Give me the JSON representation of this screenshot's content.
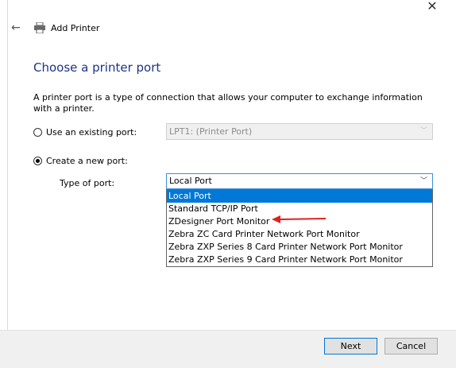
{
  "window": {
    "title": "Add Printer",
    "close_glyph": "✕"
  },
  "icons": {
    "back": "back-arrow-icon",
    "printer": "printer-icon",
    "close": "close-icon"
  },
  "heading": "Choose a printer port",
  "description": "A printer port is a type of connection that allows your computer to exchange information with a printer.",
  "existing_port": {
    "label": "Use an existing port:",
    "selected": false,
    "value": "LPT1: (Printer Port)"
  },
  "new_port": {
    "label": "Create a new port:",
    "selected": true,
    "type_label": "Type of port:",
    "value": "Local Port"
  },
  "dropdown": {
    "items": [
      "Local Port",
      "Standard TCP/IP Port",
      "ZDesigner Port Monitor",
      "Zebra ZC Card Printer Network Port Monitor",
      "Zebra ZXP Series 8 Card Printer Network Port Monitor",
      "Zebra ZXP Series 9 Card Printer Network Port Monitor"
    ],
    "highlighted_index": 0,
    "annotated_index": 2
  },
  "buttons": {
    "next": "Next",
    "cancel": "Cancel"
  },
  "colors": {
    "heading": "#1e3287",
    "selection": "#0078d7",
    "annotation": "#e02020"
  }
}
